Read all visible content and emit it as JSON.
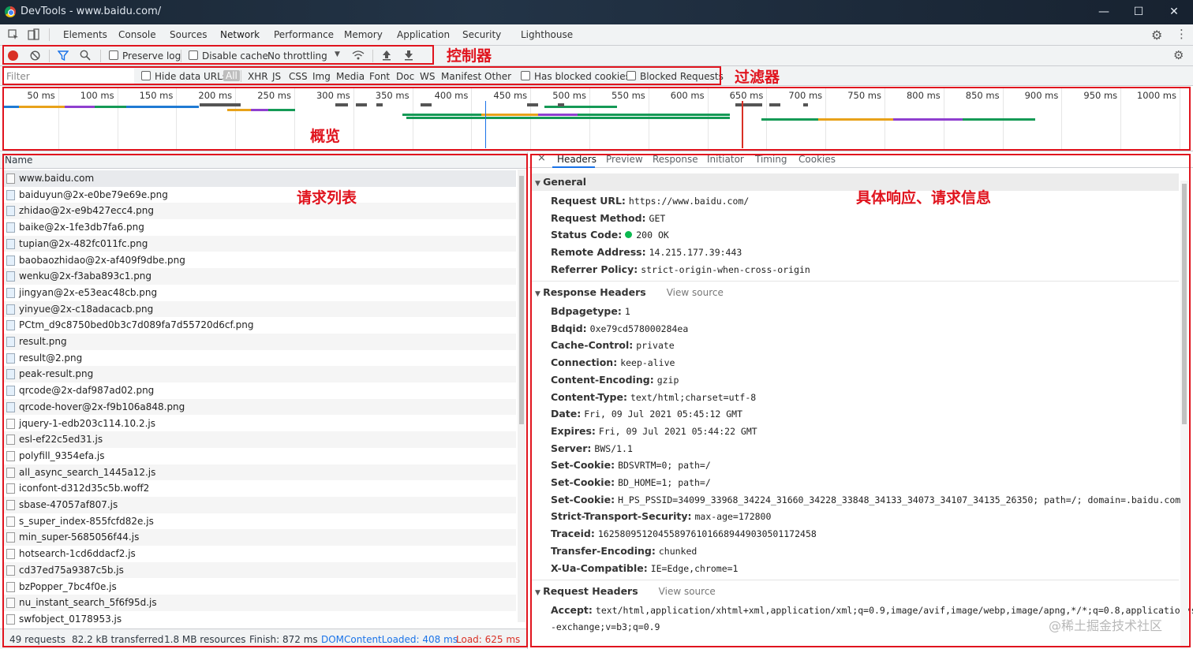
{
  "window": {
    "title": "DevTools - www.baidu.com/",
    "minimize": "—",
    "maximize": "☐",
    "close": "✕"
  },
  "tabs": [
    "Elements",
    "Console",
    "Sources",
    "Network",
    "Performance",
    "Memory",
    "Application",
    "Security",
    "Lighthouse"
  ],
  "active_tab": "Network",
  "controls": {
    "preserve_log": "Preserve log",
    "disable_cache": "Disable cache",
    "throttling": "No throttling"
  },
  "filter": {
    "placeholder": "Filter",
    "hide_data_urls": "Hide data URLs",
    "types": [
      "All",
      "XHR",
      "JS",
      "CSS",
      "Img",
      "Media",
      "Font",
      "Doc",
      "WS",
      "Manifest",
      "Other"
    ],
    "has_blocked_cookies": "Has blocked cookies",
    "blocked_requests": "Blocked Requests"
  },
  "annotations": {
    "controls": "控制器",
    "filter": "过滤器",
    "overview": "概览",
    "request_list": "请求列表",
    "detail": "具体响应、请求信息"
  },
  "overview": {
    "ticks": [
      "50 ms",
      "100 ms",
      "150 ms",
      "200 ms",
      "250 ms",
      "300 ms",
      "350 ms",
      "400 ms",
      "450 ms",
      "500 ms",
      "550 ms",
      "600 ms",
      "650 ms",
      "700 ms",
      "750 ms",
      "800 ms",
      "850 ms",
      "900 ms",
      "950 ms",
      "1000 ms"
    ],
    "colors": {
      "dcl": "#1a73e8",
      "load": "#d93025",
      "html": "#1f7ad3",
      "script": "#e8a21a",
      "image": "#8f3fcf",
      "font": "#159a56",
      "other": "#555555"
    }
  },
  "list": {
    "header": "Name",
    "items": [
      "www.baidu.com",
      "baiduyun@2x-e0be79e69e.png",
      "zhidao@2x-e9b427ecc4.png",
      "baike@2x-1fe3db7fa6.png",
      "tupian@2x-482fc011fc.png",
      "baobaozhidao@2x-af409f9dbe.png",
      "wenku@2x-f3aba893c1.png",
      "jingyan@2x-e53eac48cb.png",
      "yinyue@2x-c18adacacb.png",
      "PCtm_d9c8750bed0b3c7d089fa7d55720d6cf.png",
      "result.png",
      "result@2.png",
      "peak-result.png",
      "qrcode@2x-daf987ad02.png",
      "qrcode-hover@2x-f9b106a848.png",
      "jquery-1-edb203c114.10.2.js",
      "esl-ef22c5ed31.js",
      "polyfill_9354efa.js",
      "all_async_search_1445a12.js",
      "iconfont-d312d35c5b.woff2",
      "sbase-47057af807.js",
      "s_super_index-855fcfd82e.js",
      "min_super-5685056f44.js",
      "hotsearch-1cd6ddacf2.js",
      "cd37ed75a9387c5b.js",
      "bzPopper_7bc4f0e.js",
      "nu_instant_search_5f6f95d.js",
      "swfobject_0178953.js"
    ]
  },
  "status": {
    "requests": "49 requests",
    "transferred": "82.2 kB transferred",
    "resources": "1.8 MB resources",
    "finish": "Finish: 872 ms",
    "dom": "DOMContentLoaded: 408 ms",
    "load": "Load: 625 ms"
  },
  "detail": {
    "tabs": [
      "Headers",
      "Preview",
      "Response",
      "Initiator",
      "Timing",
      "Cookies"
    ],
    "active_tab": "Headers",
    "general_title": "General",
    "general": [
      {
        "k": "Request URL:",
        "v": "https://www.baidu.com/"
      },
      {
        "k": "Request Method:",
        "v": "GET"
      },
      {
        "k": "Status Code:",
        "v": "200  OK"
      },
      {
        "k": "Remote Address:",
        "v": "14.215.177.39:443"
      },
      {
        "k": "Referrer Policy:",
        "v": "strict-origin-when-cross-origin"
      }
    ],
    "response_title": "Response Headers",
    "view_source": "View source",
    "response": [
      {
        "k": "Bdpagetype:",
        "v": "1"
      },
      {
        "k": "Bdqid:",
        "v": "0xe79cd578000284ea"
      },
      {
        "k": "Cache-Control:",
        "v": "private"
      },
      {
        "k": "Connection:",
        "v": "keep-alive"
      },
      {
        "k": "Content-Encoding:",
        "v": "gzip"
      },
      {
        "k": "Content-Type:",
        "v": "text/html;charset=utf-8"
      },
      {
        "k": "Date:",
        "v": "Fri, 09 Jul 2021 05:45:12 GMT"
      },
      {
        "k": "Expires:",
        "v": "Fri, 09 Jul 2021 05:44:22 GMT"
      },
      {
        "k": "Server:",
        "v": "BWS/1.1"
      },
      {
        "k": "Set-Cookie:",
        "v": "BDSVRTM=0; path=/"
      },
      {
        "k": "Set-Cookie:",
        "v": "BD_HOME=1; path=/"
      },
      {
        "k": "Set-Cookie:",
        "v": "H_PS_PSSID=34099_33968_34224_31660_34228_33848_34133_34073_34107_34135_26350; path=/; domain=.baidu.com"
      },
      {
        "k": "Strict-Transport-Security:",
        "v": "max-age=172800"
      },
      {
        "k": "Traceid:",
        "v": "1625809512045589761016689449030501172458"
      },
      {
        "k": "Transfer-Encoding:",
        "v": "chunked"
      },
      {
        "k": "X-Ua-Compatible:",
        "v": "IE=Edge,chrome=1"
      }
    ],
    "request_title": "Request Headers",
    "accept_key": "Accept:",
    "accept_value": "text/html,application/xhtml+xml,application/xml;q=0.9,image/avif,image/webp,image/apng,*/*;q=0.8,application/signed",
    "accept_cont": "-exchange;v=b3;q=0.9"
  },
  "watermark": "@稀土掘金技术社区"
}
